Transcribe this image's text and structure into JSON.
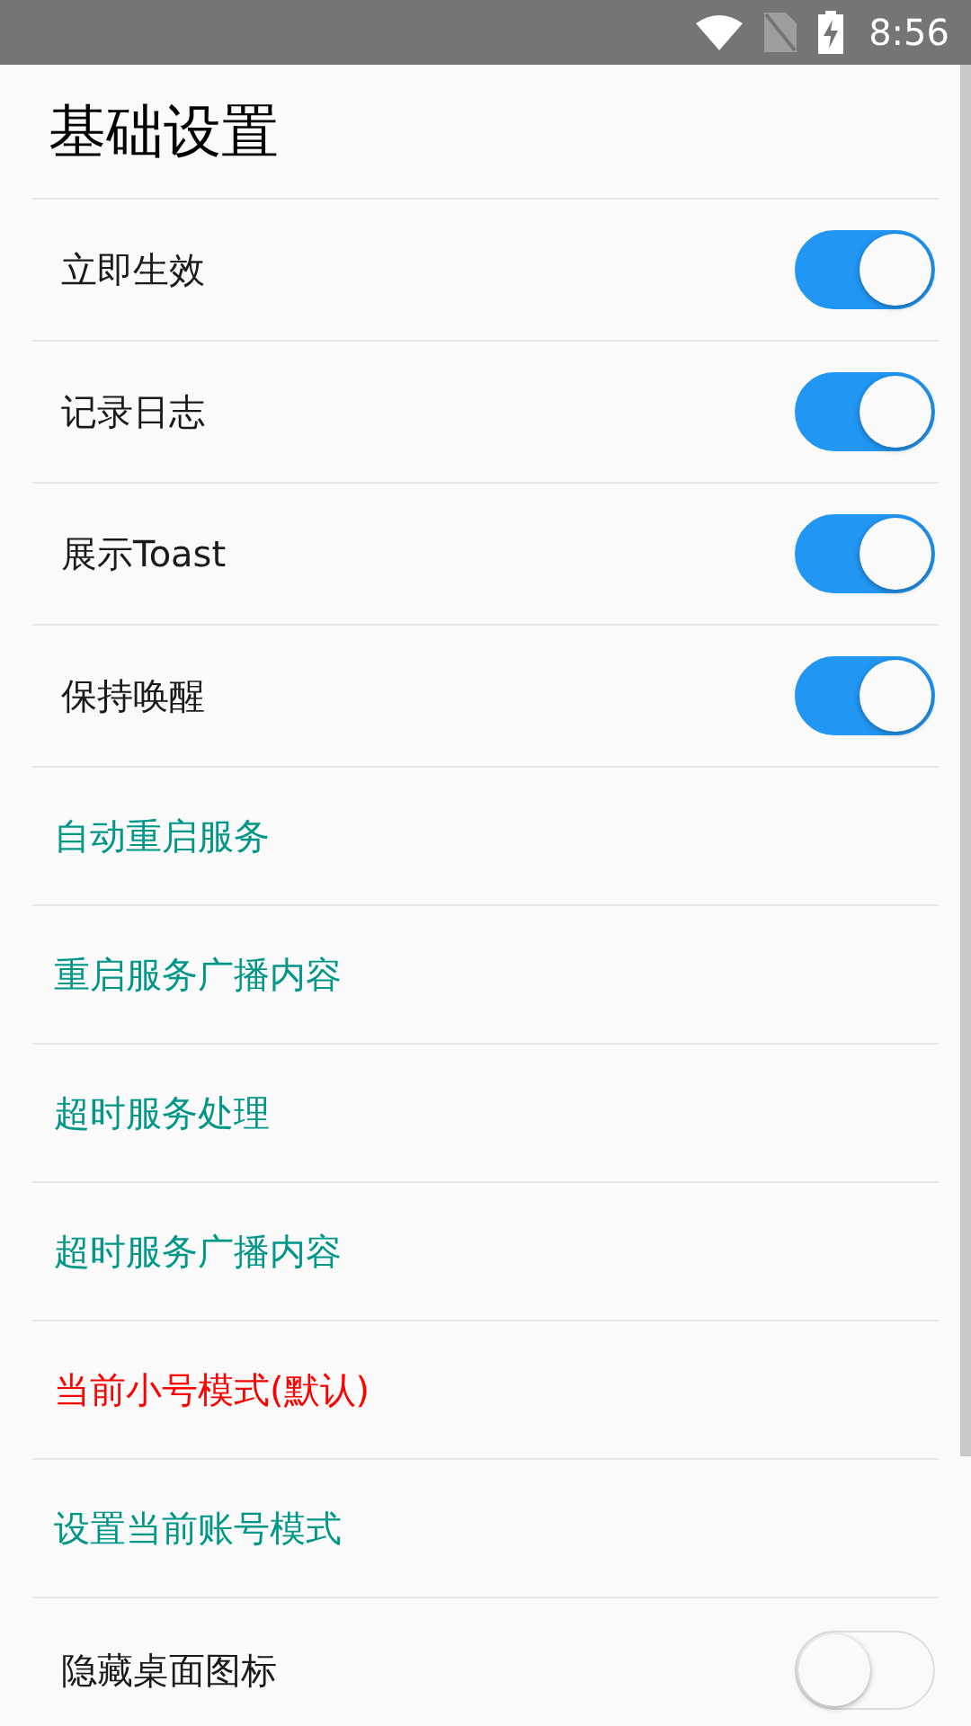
{
  "status_bar": {
    "time": "8:56"
  },
  "title": "基础设置",
  "items": [
    {
      "kind": "switch",
      "label": "立即生效",
      "on": true
    },
    {
      "kind": "switch",
      "label": "记录日志",
      "on": true
    },
    {
      "kind": "switch",
      "label": "展示Toast",
      "on": true
    },
    {
      "kind": "switch",
      "label": "保持唤醒",
      "on": true
    },
    {
      "kind": "link",
      "label": "自动重启服务",
      "color": "#009688"
    },
    {
      "kind": "link",
      "label": "重启服务广播内容",
      "color": "#009688"
    },
    {
      "kind": "link",
      "label": "超时服务处理",
      "color": "#009688"
    },
    {
      "kind": "link",
      "label": "超时服务广播内容",
      "color": "#009688"
    },
    {
      "kind": "link",
      "label": "当前小号模式(默认)",
      "color": "#ff0000"
    },
    {
      "kind": "link",
      "label": "设置当前账号模式",
      "color": "#009688"
    },
    {
      "kind": "switch",
      "label": "隐藏桌面图标",
      "on": false
    }
  ]
}
